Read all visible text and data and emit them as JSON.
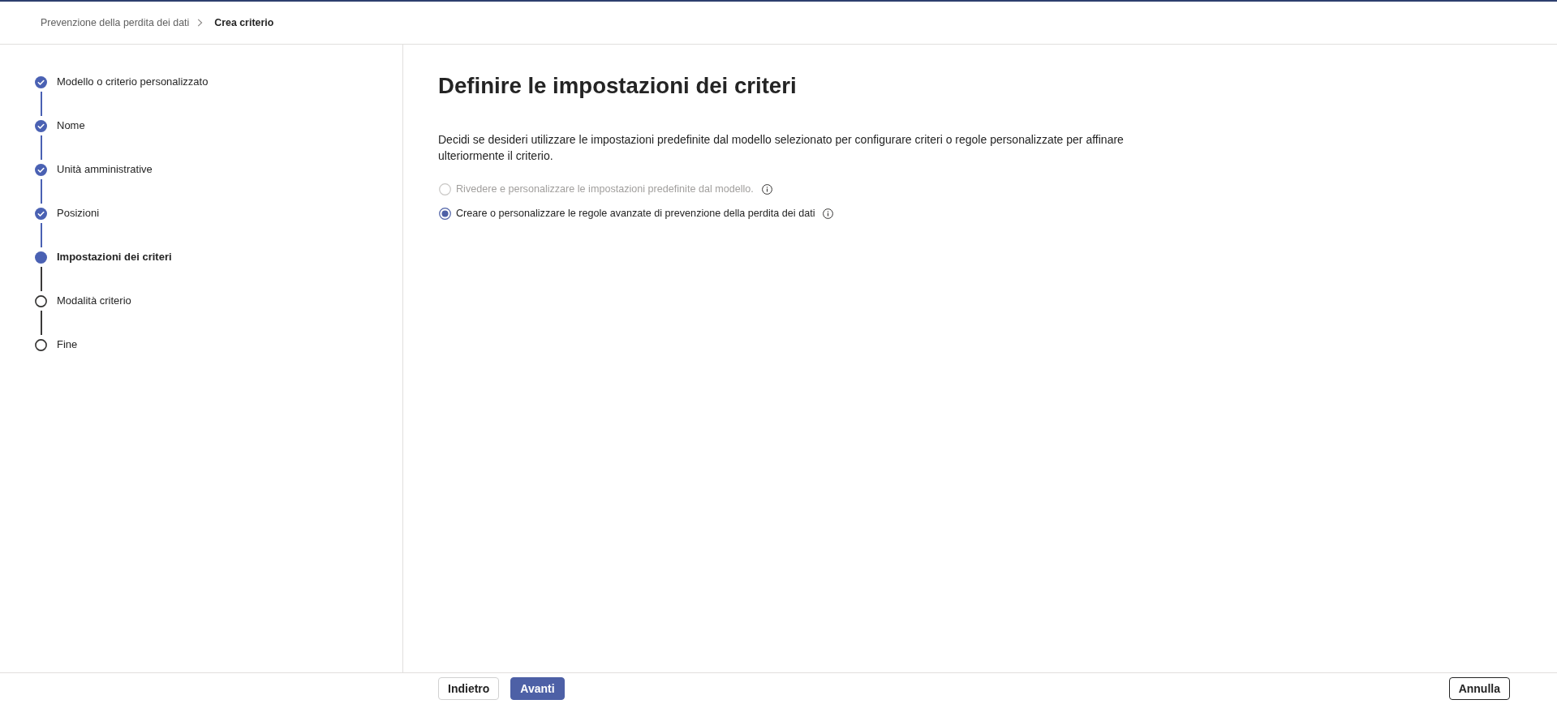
{
  "breadcrumb": [
    {
      "label": "Prevenzione della perdita dei dati",
      "current": false
    },
    {
      "label": "Crea criterio",
      "current": true
    }
  ],
  "steps": [
    {
      "label": "Modello o criterio personalizzato",
      "completed": true,
      "selected": false
    },
    {
      "label": "Nome",
      "completed": true,
      "selected": false
    },
    {
      "label": "Unità amministrative",
      "completed": true,
      "selected": false
    },
    {
      "label": "Posizioni",
      "completed": true,
      "selected": false
    },
    {
      "label": "Impostazioni dei criteri",
      "completed": false,
      "selected": true
    },
    {
      "label": "Modalità criterio",
      "completed": false,
      "selected": false
    },
    {
      "label": "Fine",
      "completed": false,
      "selected": false
    }
  ],
  "main": {
    "title": "Definire le impostazioni dei criteri",
    "description": "Decidi se desideri utilizzare le impostazioni predefinite dal modello selezionato per configurare criteri o regole personalizzate per affinare ulteriormente il criterio.",
    "options": [
      {
        "label": "Rivedere e personalizzare le impostazioni predefinite dal modello.",
        "selected": false,
        "disabled": true
      },
      {
        "label": "Creare o personalizzare le regole avanzate di prevenzione della perdita dei dati",
        "selected": true,
        "disabled": false
      }
    ]
  },
  "footer": {
    "navigation": [
      {
        "label": "Indietro",
        "kind": "secondary"
      },
      {
        "label": "Avanti",
        "kind": "primary"
      }
    ],
    "cancel": {
      "label": "Annulla"
    }
  }
}
